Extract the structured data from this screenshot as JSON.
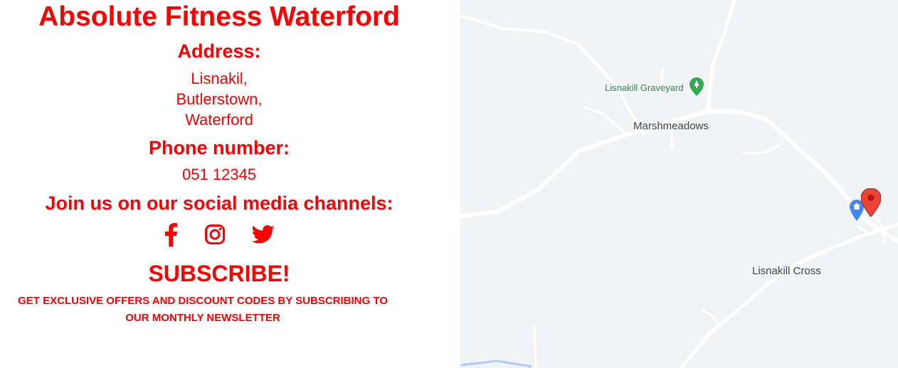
{
  "contact": {
    "title": "Absolute Fitness Waterford",
    "address_heading": "Address:",
    "address_lines": [
      "Lisnakil,",
      "Butlerstown,",
      "Waterford"
    ],
    "phone_heading": "Phone number:",
    "phone": "051 12345",
    "social_heading": "Join us on our social media channels:",
    "social_icons": [
      "facebook-icon",
      "instagram-icon",
      "twitter-icon"
    ],
    "subscribe_heading": "SUBSCRIBE!",
    "subscribe_text": "GET EXCLUSIVE OFFERS AND DISCOUNT CODES BY SUBSCRIBING TO OUR MONTHLY NEWSLETTER"
  },
  "map": {
    "labels": {
      "graveyard": "Lisnakill Graveyard",
      "marshmeadows": "Marshmeadows",
      "cross": "Lisnakill Cross"
    },
    "icons": [
      "tree-pin-icon",
      "home-pin-icon",
      "location-marker-icon"
    ]
  },
  "colors": {
    "accent": "#ff0000",
    "map_bg": "#f1f3f4",
    "road": "#ffffff",
    "poi_green": "#34a853",
    "pin_red": "#ea4335",
    "pin_blue": "#4285f4"
  }
}
